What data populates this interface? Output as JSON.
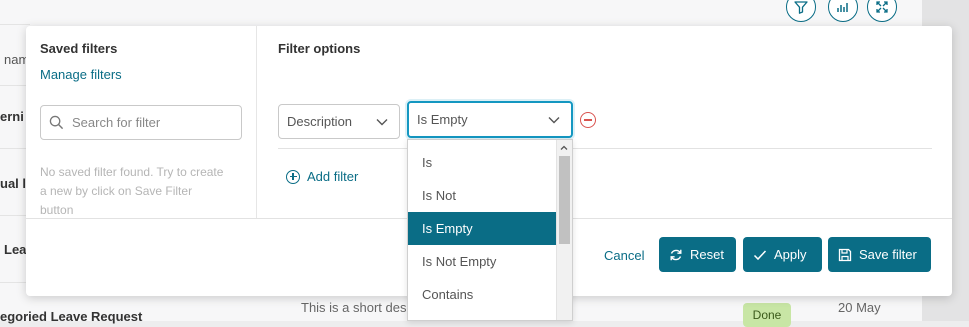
{
  "background": {
    "rows": [
      "nam",
      "erni",
      "ual l",
      "Lea",
      "egoried Leave Request"
    ],
    "description_text": "This is a short des",
    "status_badge": "Done",
    "date_text": "20 May",
    "toolbar_icons": [
      "filter-icon",
      "chart-icon",
      "expand-icon"
    ]
  },
  "saved_filters": {
    "title": "Saved filters",
    "manage_link": "Manage filters",
    "search_placeholder": "Search for filter",
    "empty_message": "No saved filter found. Try to create a new by click on Save Filter button"
  },
  "filter_options": {
    "title": "Filter options",
    "field_value": "Description",
    "operator_value": "Is Empty",
    "add_filter_label": "Add filter"
  },
  "operator_dropdown": {
    "options": [
      "Is",
      "Is Not",
      "Is Empty",
      "Is Not Empty",
      "Contains"
    ],
    "selected_index": 2
  },
  "footer": {
    "cancel_label": "Cancel",
    "reset_label": "Reset",
    "apply_label": "Apply",
    "save_label": "Save filter"
  },
  "colors": {
    "accent": "#0a6d86",
    "focus_border": "#1497c1",
    "remove": "#d9534f",
    "badge_done": "#c8e6a5"
  }
}
